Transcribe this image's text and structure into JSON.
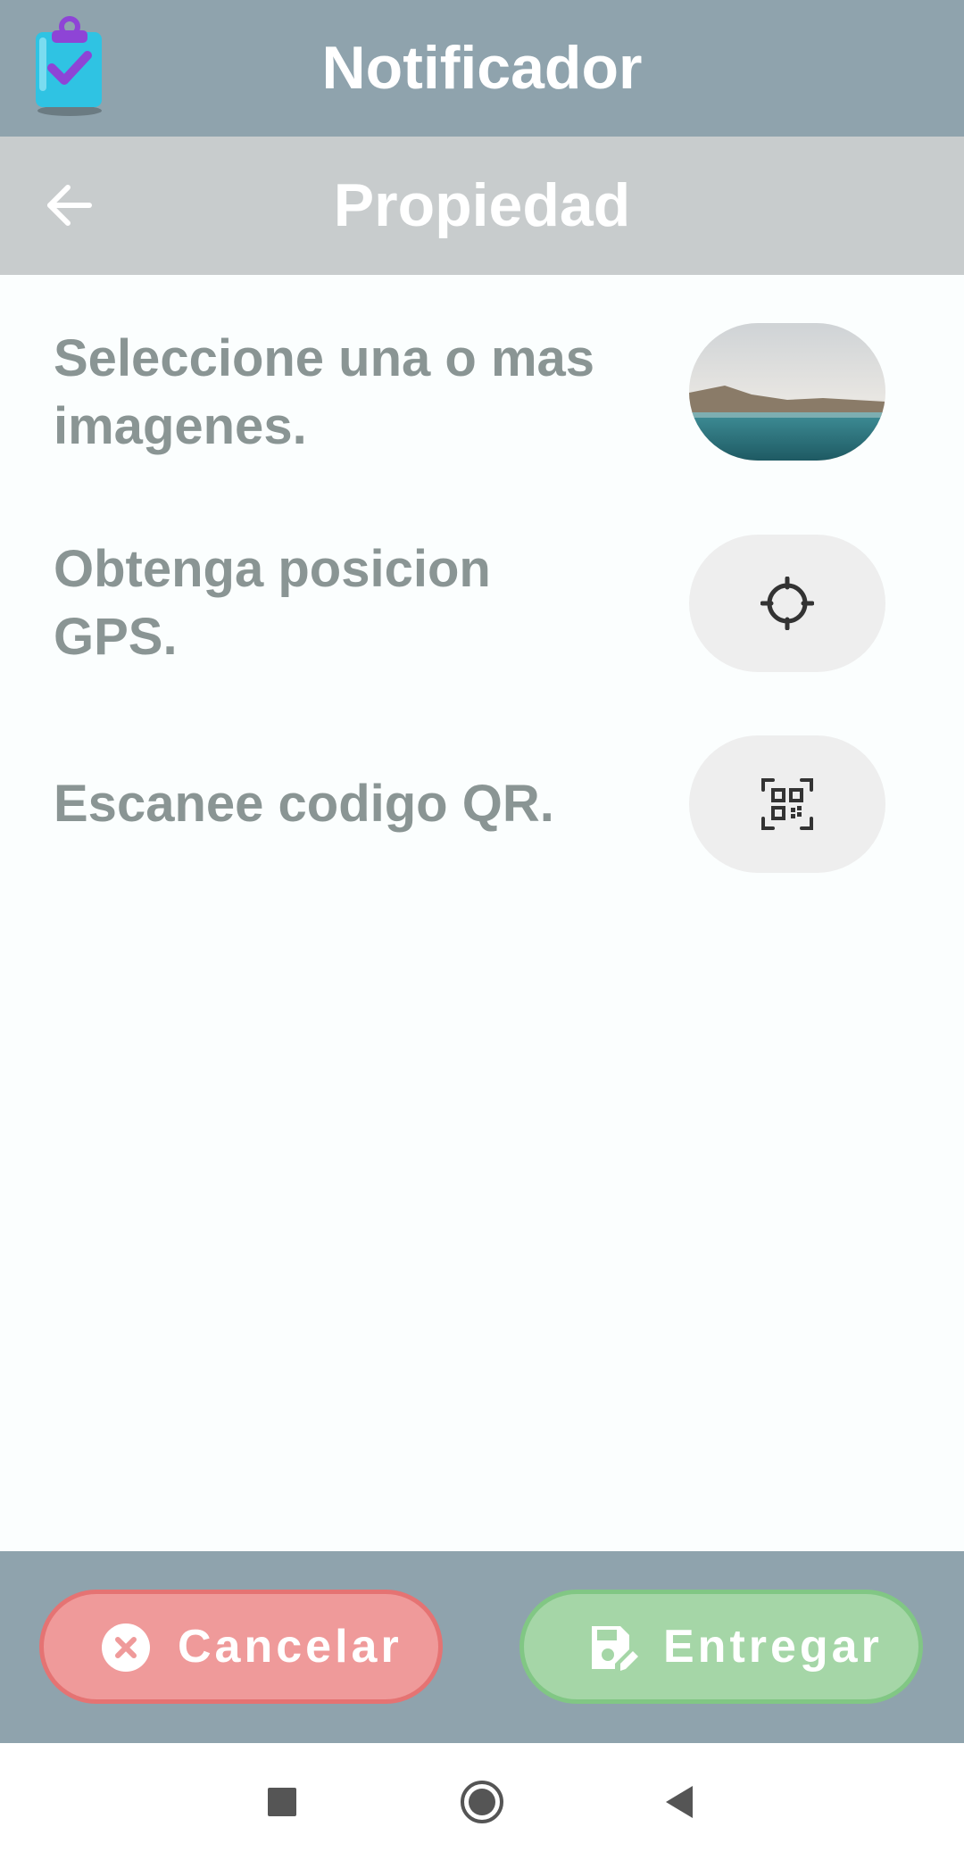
{
  "app_bar": {
    "title": "Notificador",
    "logo_icon": "clipboard-check-icon"
  },
  "sub_bar": {
    "title": "Propiedad",
    "back_icon": "arrow-left-icon"
  },
  "rows": [
    {
      "label": "Seleccione una o mas imagenes.",
      "button_icon": "image-thumbnail"
    },
    {
      "label": "Obtenga posicion GPS.",
      "button_icon": "gps-crosshair-icon"
    },
    {
      "label": "Escanee codigo QR.",
      "button_icon": "qr-scan-icon"
    }
  ],
  "actions": {
    "cancel_label": "Cancelar",
    "cancel_icon": "close-circle-icon",
    "deliver_label": "Entregar",
    "deliver_icon": "save-edit-icon"
  },
  "system_nav": {
    "recents_icon": "square-icon",
    "home_icon": "circle-icon",
    "back_icon": "triangle-back-icon"
  },
  "colors": {
    "app_bar": "#8fa3ad",
    "sub_bar": "#c8cccd",
    "label_text": "#8a9594",
    "cancel": "#ef9a9a",
    "deliver": "#a5d6a7"
  }
}
